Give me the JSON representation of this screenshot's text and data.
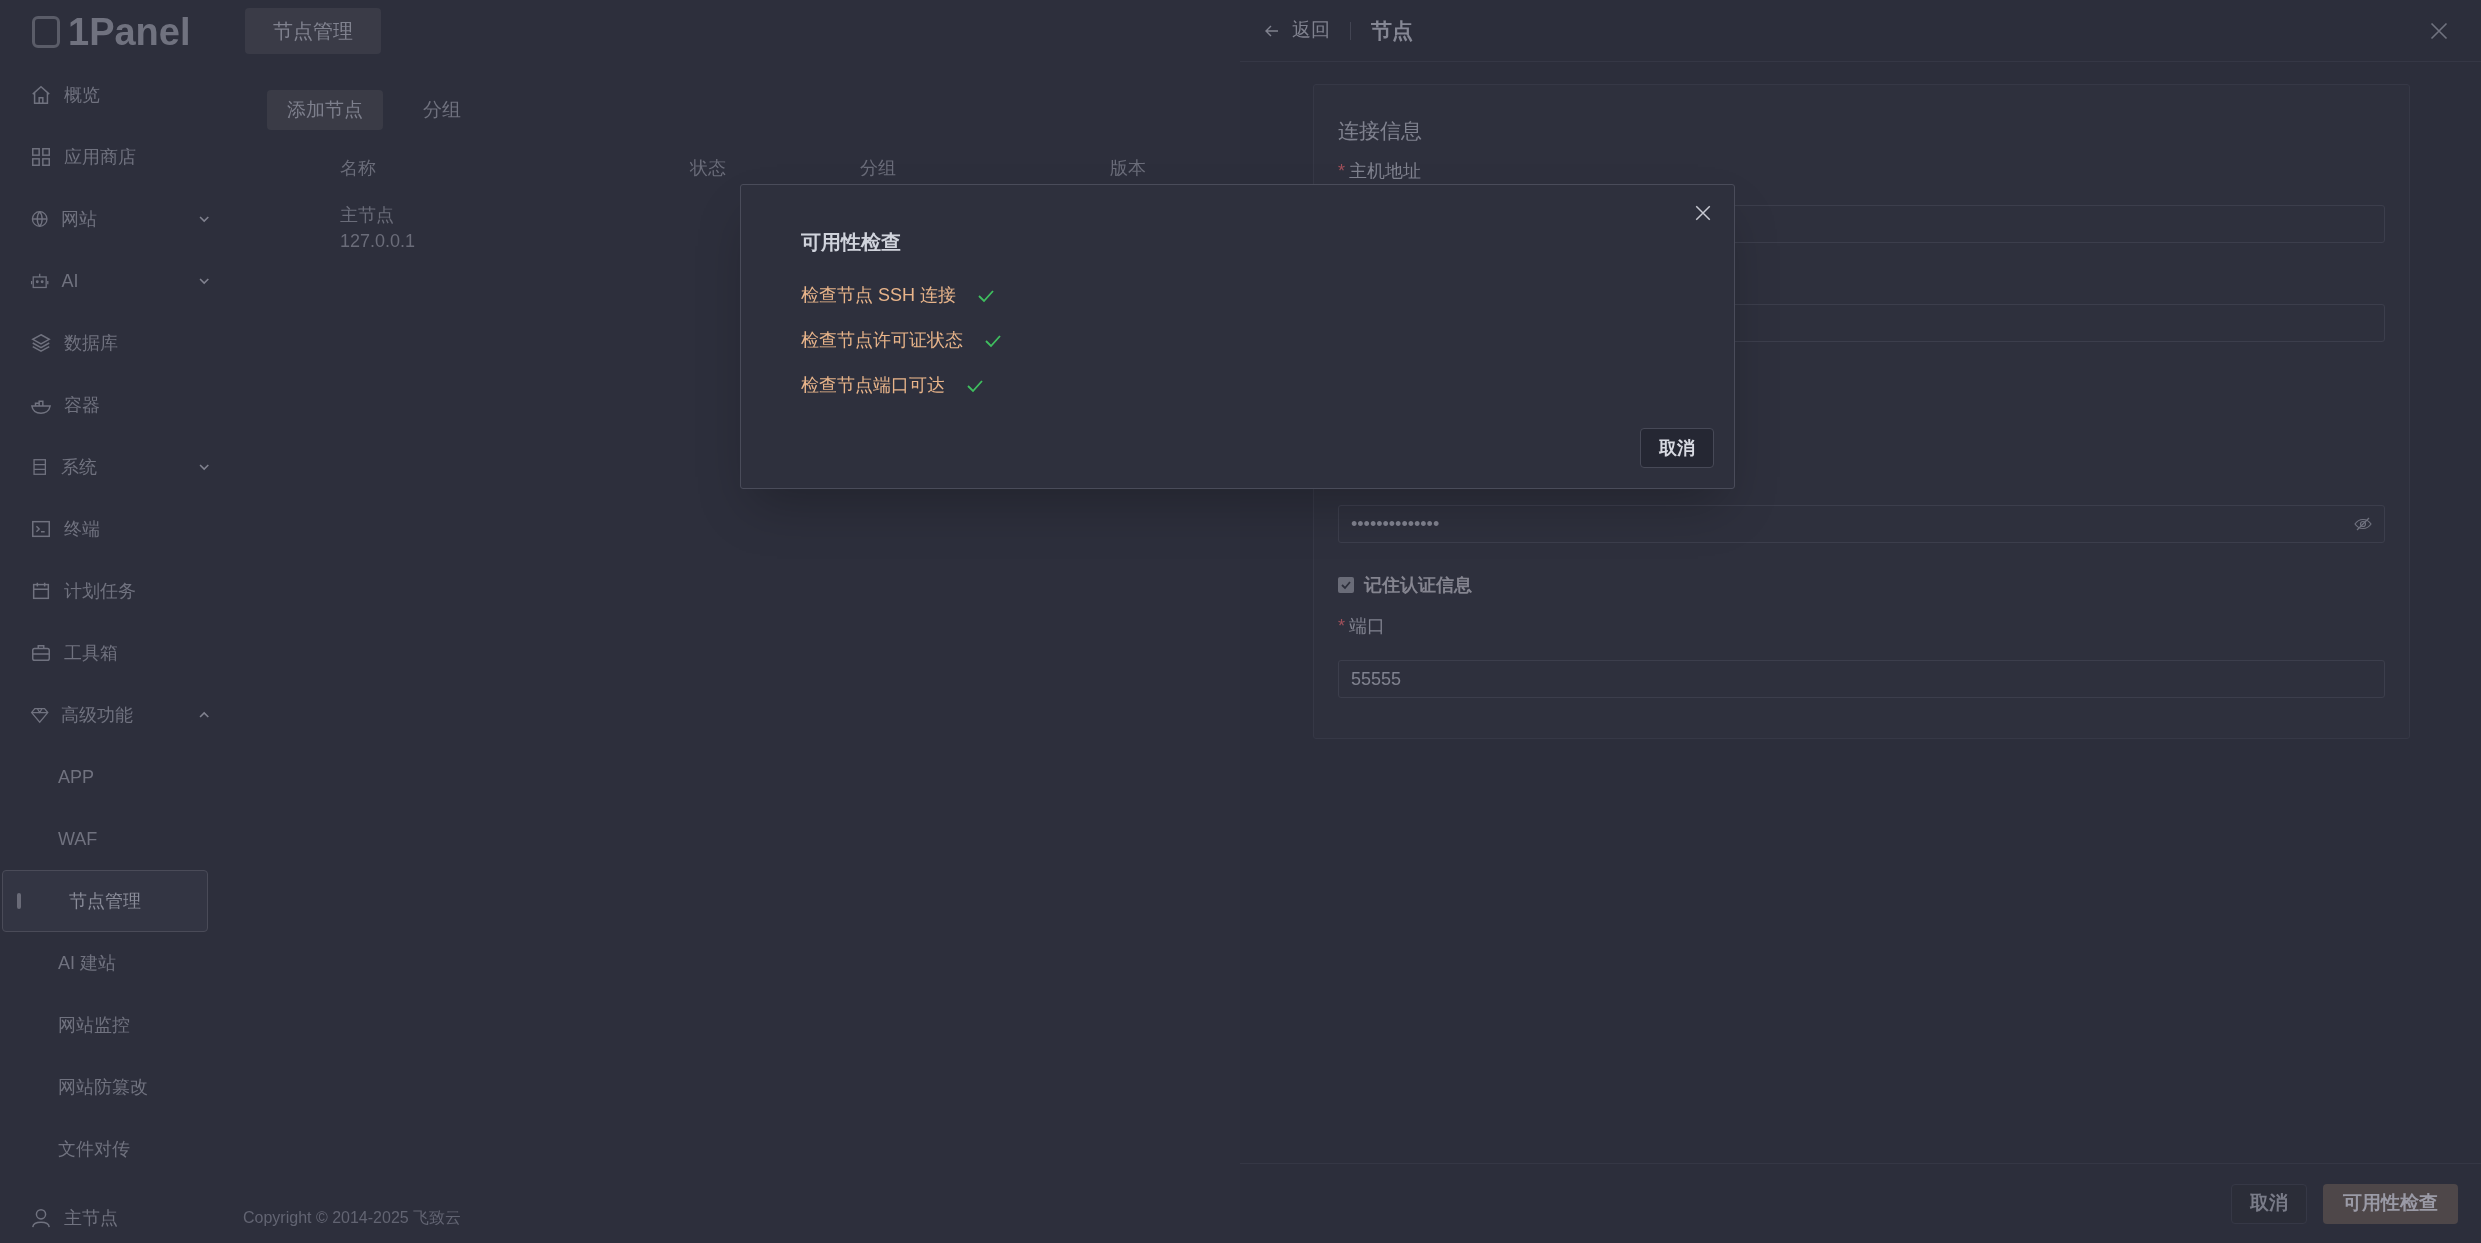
{
  "header": {
    "logo": "1Panel",
    "page_button": "节点管理"
  },
  "sidebar": {
    "items": [
      {
        "label": "概览",
        "selected": false
      },
      {
        "label": "应用商店",
        "selected": false
      },
      {
        "label": "网站",
        "selected": false,
        "expanded": false
      },
      {
        "label": "AI",
        "selected": false,
        "expanded": false
      },
      {
        "label": "数据库",
        "selected": false
      },
      {
        "label": "容器",
        "selected": false
      },
      {
        "label": "系统",
        "selected": false,
        "expanded": false
      },
      {
        "label": "终端",
        "selected": false
      },
      {
        "label": "计划任务",
        "selected": false
      },
      {
        "label": "工具箱",
        "selected": false
      },
      {
        "label": "高级功能",
        "selected": false,
        "expanded": true,
        "children": [
          {
            "label": "APP",
            "selected": false
          },
          {
            "label": "WAF",
            "selected": false
          },
          {
            "label": "节点管理",
            "selected": true
          },
          {
            "label": "AI 建站",
            "selected": false
          },
          {
            "label": "网站监控",
            "selected": false
          },
          {
            "label": "网站防篡改",
            "selected": false
          },
          {
            "label": "文件对传",
            "selected": false
          }
        ]
      }
    ],
    "user": "主节点"
  },
  "main": {
    "toolbar": [
      {
        "label": "添加节点",
        "kind": "primary"
      },
      {
        "label": "分组",
        "kind": "text"
      }
    ],
    "table": {
      "columns": [
        "名称",
        "状态",
        "分组",
        "版本"
      ],
      "rows": [
        {
          "name": "主节点",
          "address": "127.0.0.1"
        }
      ]
    },
    "copyright": "Copyright © 2014-2025 飞致云"
  },
  "drawer": {
    "back": "返回",
    "title": "节点",
    "section": "连接信息",
    "fields": [
      {
        "kind": "input",
        "label": "主机地址",
        "required": true,
        "marker": "*"
      },
      {
        "kind": "input"
      },
      {
        "kind": "password",
        "value": "••••••••••••••"
      },
      {
        "kind": "checkbox",
        "label": "记住认证信息",
        "checked": true
      },
      {
        "kind": "input",
        "label": "端口",
        "required": true,
        "marker": "*",
        "value": "55555"
      }
    ],
    "buttons": [
      {
        "label": "取消",
        "kind": "plain"
      },
      {
        "label": "可用性检查",
        "kind": "primary"
      }
    ]
  },
  "dialog": {
    "title": "可用性检查",
    "checks": [
      {
        "label": "检查节点 SSH 连接",
        "passed": true
      },
      {
        "label": "检查节点许可证状态",
        "passed": true
      },
      {
        "label": "检查节点端口可达",
        "passed": true
      }
    ],
    "cancel": "取消"
  }
}
